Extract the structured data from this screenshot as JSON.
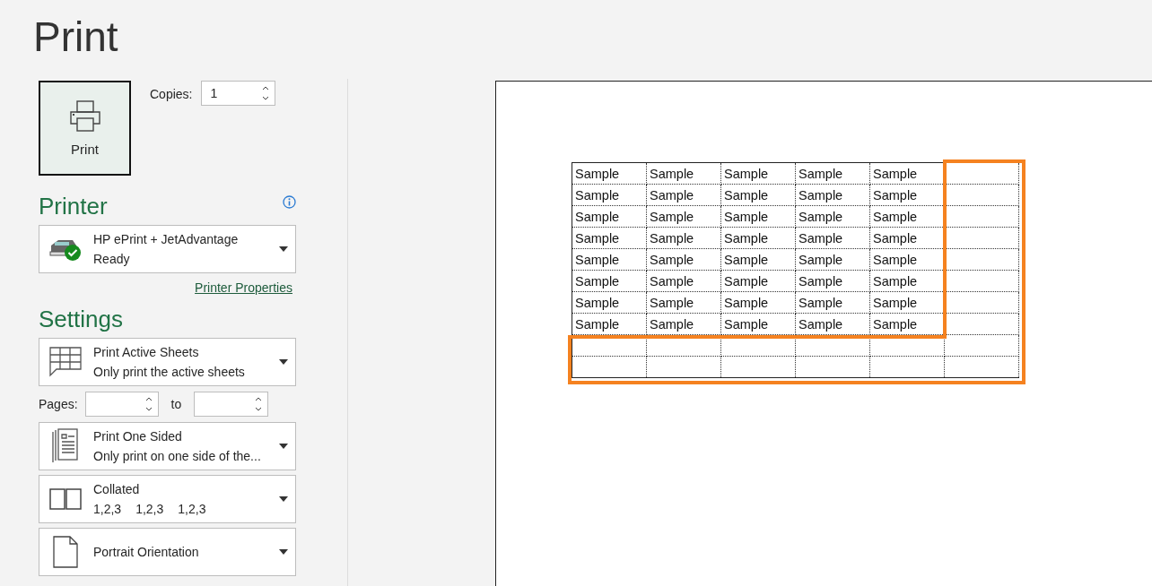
{
  "title": "Print",
  "print_button": {
    "label": "Print"
  },
  "copies": {
    "label": "Copies:",
    "value": "1"
  },
  "printer": {
    "heading": "Printer",
    "name": "HP ePrint + JetAdvantage",
    "status": "Ready",
    "ready": true,
    "properties_link": "Printer Properties"
  },
  "settings": {
    "heading": "Settings",
    "items": [
      {
        "kind": "sheets",
        "title": "Print Active Sheets",
        "subtitle": "Only print the active sheets"
      },
      {
        "kind": "pages",
        "label": "Pages:",
        "to_label": "to"
      },
      {
        "kind": "sided",
        "title": "Print One Sided",
        "subtitle": "Only print on one side of the..."
      },
      {
        "kind": "collate",
        "title": "Collated",
        "subtitle_parts": [
          "1,2,3",
          "1,2,3",
          "1,2,3"
        ]
      },
      {
        "kind": "orientation",
        "title": "Portrait Orientation"
      }
    ]
  },
  "preview": {
    "highlight_shown": true,
    "rows": [
      [
        "Sample",
        "Sample",
        "Sample",
        "Sample",
        "Sample"
      ],
      [
        "Sample",
        "Sample",
        "Sample",
        "Sample",
        "Sample"
      ],
      [
        "Sample",
        "Sample",
        "Sample",
        "Sample",
        "Sample"
      ],
      [
        "Sample",
        "Sample",
        "Sample",
        "Sample",
        "Sample"
      ],
      [
        "Sample",
        "Sample",
        "Sample",
        "Sample",
        "Sample"
      ],
      [
        "Sample",
        "Sample",
        "Sample",
        "Sample",
        "Sample"
      ],
      [
        "Sample",
        "Sample",
        "Sample",
        "Sample",
        "Sample"
      ],
      [
        "Sample",
        "Sample",
        "Sample",
        "Sample",
        "Sample"
      ]
    ]
  }
}
